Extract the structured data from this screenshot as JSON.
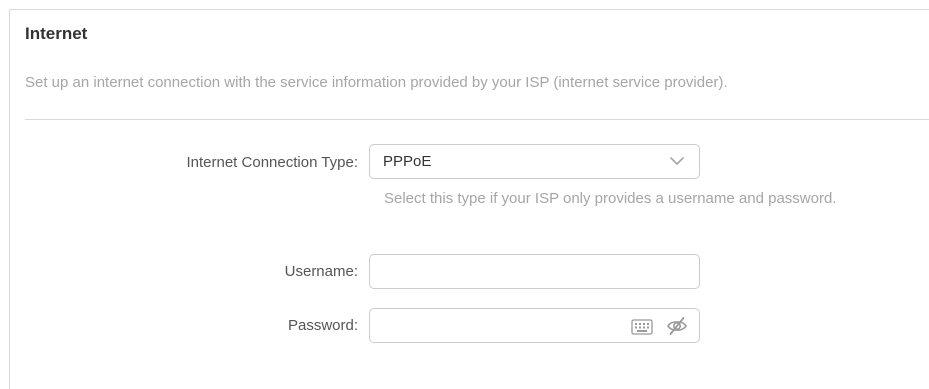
{
  "section": {
    "title": "Internet",
    "description": "Set up an internet connection with the service information provided by your ISP (internet service provider)."
  },
  "form": {
    "connection_type": {
      "label": "Internet Connection Type:",
      "selected": "PPPoE",
      "hint": "Select this type if your ISP only provides a username and password.",
      "icon": "chevron-down-icon"
    },
    "username": {
      "label": "Username:",
      "value": "",
      "placeholder": ""
    },
    "password": {
      "label": "Password:",
      "value": "",
      "placeholder": "",
      "icons": [
        "keyboard-icon",
        "eye-slash-icon"
      ]
    }
  },
  "colors": {
    "title": "#333333",
    "muted_text": "#a6a6a6",
    "label": "#555555",
    "border": "#cccccc",
    "divider": "#d9d9d9"
  }
}
